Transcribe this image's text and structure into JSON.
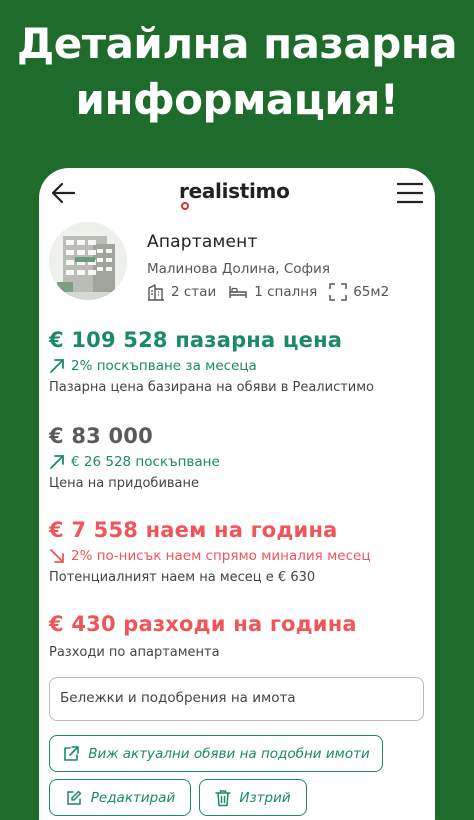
{
  "promo": {
    "line1": "Детайлна пазарна",
    "line2": "информация!"
  },
  "app": {
    "logo": "realistimo",
    "back_icon": "arrow-left-icon",
    "menu_icon": "hamburger-icon"
  },
  "listing": {
    "type": "Апартамент",
    "location": "Малинова Долина, София",
    "rooms": "2 стаи",
    "bedrooms": "1 спалня",
    "area": "65м2"
  },
  "market": {
    "price": "€ 109 528 пазарна цена",
    "trend": "2% поскъпване за месеца",
    "note": "Пазарна цена базирана на обяви в Реалистимо"
  },
  "purchase": {
    "price": "€ 83 000",
    "trend": "€ 26 528 поскъпване",
    "note": "Цена на придобиване"
  },
  "rent": {
    "price": "€ 7 558 наем на година",
    "trend": "2% по-нисък наем спрямо миналия месец",
    "note": "Потенциалният наем на месец е € 630"
  },
  "costs": {
    "price": "€ 430 разходи на година",
    "note": "Разходи по апартамента"
  },
  "notes_field": {
    "placeholder": "Бележки и подобрения на имота"
  },
  "actions": {
    "similar": "Виж актуални обяви на подобни имоти",
    "edit": "Редактирай",
    "delete": "Изтрий"
  },
  "colors": {
    "background": "#1f6b2c",
    "accent_green": "#1a8a6a",
    "accent_red": "#f0555a"
  }
}
